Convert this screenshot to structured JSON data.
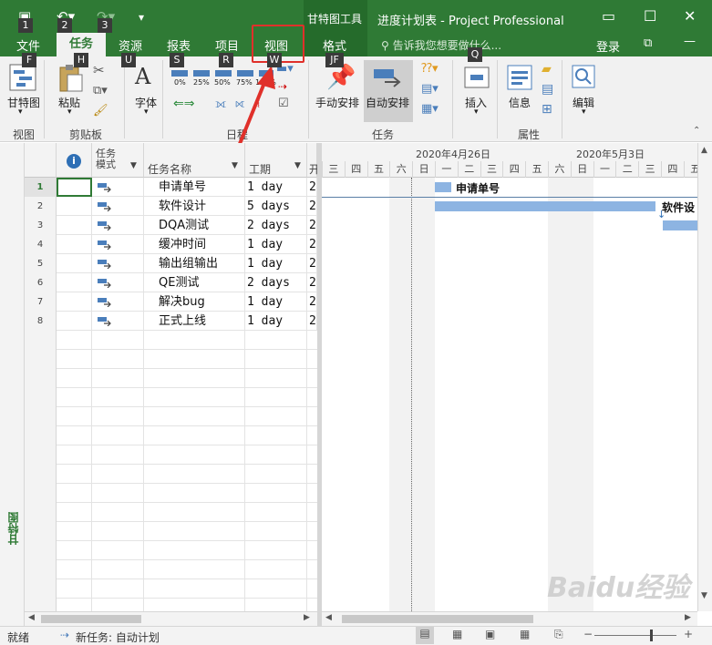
{
  "titlebar": {
    "context_label": "甘特图工具",
    "doc_title": "进度计划表 - Project Professional",
    "minimize": "—",
    "maximize": "☐",
    "close": "✕",
    "restore": "⧉",
    "login": "登录",
    "tell_me": "告诉我您想要做什么..."
  },
  "qat_keytips": [
    "1",
    "2",
    "3"
  ],
  "tabs": [
    {
      "label": "文件",
      "keytip": "F"
    },
    {
      "label": "任务",
      "keytip": "H"
    },
    {
      "label": "资源",
      "keytip": "U"
    },
    {
      "label": "报表",
      "keytip": "S"
    },
    {
      "label": "项目",
      "keytip": "R"
    },
    {
      "label": "视图",
      "keytip": "W"
    },
    {
      "label": "格式",
      "keytip": "JF"
    }
  ],
  "tell_keytip": "Q",
  "ribbon": {
    "gantt_label": "甘特图",
    "paste_label": "粘贴",
    "font_label": "字体",
    "pct_labels": [
      "0%",
      "25%",
      "50%",
      "75%",
      "100%"
    ],
    "manual_label": "手动安排",
    "auto_label": "自动安排",
    "insert_label": "插入",
    "info_label": "信息",
    "edit_label": "编辑",
    "groups": {
      "view": "视图",
      "clipboard": "剪贴板",
      "schedule": "日程",
      "tasks": "任务",
      "properties": "属性"
    }
  },
  "sidebar": {
    "label": "甘特图"
  },
  "columns": {
    "mode": "任务\n模式",
    "name": "任务名称",
    "duration": "工期",
    "start": "开"
  },
  "tasks": [
    {
      "num": "1",
      "name": "申请单号",
      "duration": "1 day",
      "start": "2"
    },
    {
      "num": "2",
      "name": "软件设计",
      "duration": "5 days",
      "start": "2"
    },
    {
      "num": "3",
      "name": "DQA测试",
      "duration": "2 days",
      "start": "2"
    },
    {
      "num": "4",
      "name": "缓冲时间",
      "duration": "1 day",
      "start": "2"
    },
    {
      "num": "5",
      "name": "输出组输出",
      "duration": "1 day",
      "start": "2"
    },
    {
      "num": "6",
      "name": "QE测试",
      "duration": "2 days",
      "start": "2"
    },
    {
      "num": "7",
      "name": "解决bug",
      "duration": "1 day",
      "start": "2"
    },
    {
      "num": "8",
      "name": "正式上线",
      "duration": "1 day",
      "start": "2"
    }
  ],
  "gantt": {
    "week1": "2020年4月26日",
    "week2": "2020年5月3日",
    "days": [
      "三",
      "四",
      "五",
      "六",
      "日",
      "一",
      "二",
      "三",
      "四",
      "五",
      "六",
      "日",
      "一",
      "二",
      "三",
      "四",
      "五"
    ],
    "bar_label_1": "申请单号",
    "bar_label_2": "软件设"
  },
  "status": {
    "ready": "就绪",
    "new_task": "新任务: 自动计划"
  },
  "watermark": "Baidu经验",
  "colors": {
    "title_green": "#2f7a35",
    "bar_blue": "#8db4e2",
    "highlight_red": "#e0302a"
  }
}
